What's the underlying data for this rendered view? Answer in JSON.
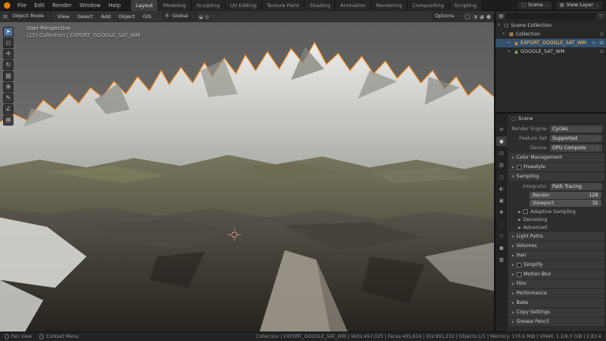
{
  "app": {
    "name": "Blender"
  },
  "colors": {
    "accent_orange": "#e87d0d",
    "selection_outline": "#ff8c1a",
    "selection_blue": "#33506b",
    "panel_bg": "#2d2d2d"
  },
  "icons": {
    "arrow_right": "▸",
    "arrow_down": "▾",
    "chevron_down": "⌄",
    "grid": "⊞",
    "globe": "◐",
    "magnet": "◒",
    "proportional": "◎",
    "funnel": "▽",
    "collection": "▦",
    "mesh": "▲",
    "eye": "⊙",
    "link": "∞",
    "camera": "◉",
    "scene": "▢",
    "shading_modes": [
      "◯",
      "◑",
      "◕",
      "●"
    ],
    "toolbar": [
      "➤",
      "◻",
      "✛",
      "↻",
      "▧",
      "⊕",
      "✎",
      "∠",
      "⊞"
    ],
    "ptabs": [
      "⚙",
      "◉",
      "⊡",
      "▤",
      "▢",
      "◐",
      "▣",
      "✱",
      "◌",
      "▽",
      "●",
      "▦"
    ]
  },
  "topbar": {
    "menus": [
      "File",
      "Edit",
      "Render",
      "Window",
      "Help"
    ],
    "workspaces": [
      "Layout",
      "Modeling",
      "Sculpting",
      "UV Editing",
      "Texture Paint",
      "Shading",
      "Animation",
      "Rendering",
      "Compositing",
      "Scripting"
    ],
    "active_workspace": "Layout",
    "scene": "Scene",
    "view_layer": "View Layer"
  },
  "viewport_header": {
    "mode": "Object Mode",
    "menus": [
      "View",
      "Select",
      "Add",
      "Object",
      "GIS"
    ],
    "orientation": "Global",
    "options": "Options"
  },
  "viewport": {
    "perspective": "User Perspective",
    "collection": "(15) Collection | EXPORT_GOOGLE_SAT_WM"
  },
  "outliner": {
    "root": "Scene Collection",
    "items": [
      {
        "label": "Collection"
      },
      {
        "label": "EXPORT_GOOGLE_SAT_WM",
        "selected": true
      },
      {
        "label": "GOOGLE_SAT_WM"
      }
    ]
  },
  "properties": {
    "breadcrumb": "Scene",
    "fields": [
      {
        "label": "Render Engine",
        "value": "Cycles"
      },
      {
        "label": "Feature Set",
        "value": "Supported"
      },
      {
        "label": "Device",
        "value": "GPU Compute"
      }
    ],
    "sections_top": [
      "Color Management",
      "Freestyle"
    ],
    "sampling": {
      "title": "Sampling",
      "integrator_label": "Integrator",
      "integrator": "Path Tracing",
      "render_label": "Render",
      "render": "128",
      "viewport_label": "Viewport",
      "viewport": "32",
      "sub": [
        "Adaptive Sampling",
        "Denoising",
        "Advanced"
      ]
    },
    "sections_bottom": [
      "Light Paths",
      "Volumes",
      "Hair",
      "Simplify",
      "Motion Blur",
      "Film",
      "Performance",
      "Bake",
      "Copy Settings",
      "Grease Pencil"
    ]
  },
  "statusbar": {
    "hints": [
      "Pan View",
      "Context Menu"
    ],
    "stats": "Collection | EXPORT_GOOGLE_SAT_WM | Verts:497,025 | Faces:495,616 | Tris:991,232 | Objects:1/1 | Memory: 176.6 MiB | VRAM: 1.2/8.0 GiB | 2.83.4"
  }
}
